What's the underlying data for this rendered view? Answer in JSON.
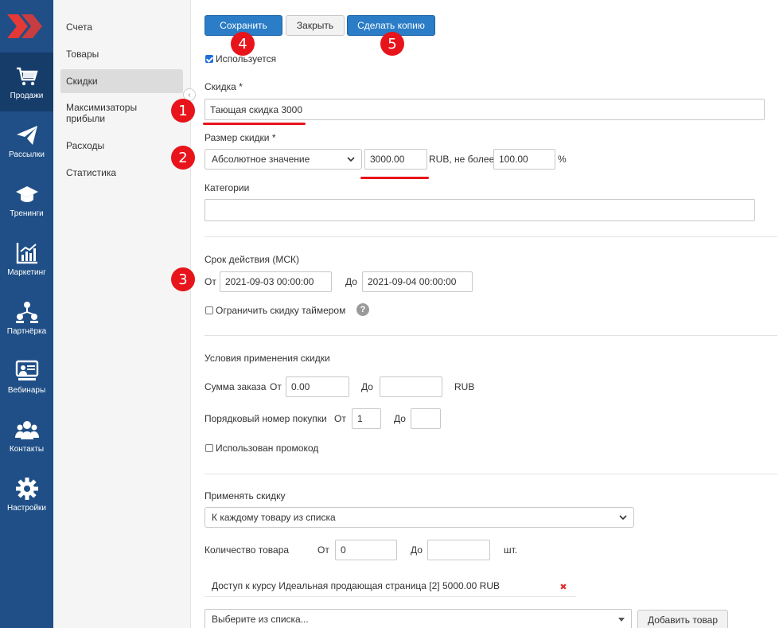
{
  "rail": {
    "items": [
      {
        "label": "Продажи",
        "icon": "cart-icon"
      },
      {
        "label": "Рассылки",
        "icon": "paper-plane-icon"
      },
      {
        "label": "Тренинги",
        "icon": "graduation-cap-icon"
      },
      {
        "label": "Маркетинг",
        "icon": "chart-icon"
      },
      {
        "label": "Партнёрка",
        "icon": "partners-icon"
      },
      {
        "label": "Вебинары",
        "icon": "webinar-icon"
      },
      {
        "label": "Контакты",
        "icon": "contacts-icon"
      },
      {
        "label": "Настройки",
        "icon": "gear-icon"
      }
    ]
  },
  "submenu": {
    "items": [
      {
        "label": "Счета"
      },
      {
        "label": "Товары"
      },
      {
        "label": "Скидки"
      },
      {
        "label": "Максимизаторы прибыли"
      },
      {
        "label": "Расходы"
      },
      {
        "label": "Статистика"
      }
    ]
  },
  "toolbar": {
    "save_label": "Сохранить",
    "close_label": "Закрыть",
    "copy_label": "Сделать копию"
  },
  "form": {
    "active_label": "Используется",
    "discount_label": "Скидка *",
    "discount_value": "Тающая скидка 3000",
    "size_label": "Размер скидки *",
    "size_type": "Абсолютное значение",
    "size_value": "3000.00",
    "size_suffix": "RUB, не более",
    "max_value": "100.00",
    "percent": "%",
    "categories_label": "Категории",
    "categories_value": "",
    "period_label": "Срок действия (МСК)",
    "from_label": "От",
    "from_value": "2021-09-03 00:00:00",
    "to_label": "До",
    "to_value": "2021-09-04 00:00:00",
    "timer_label": "Ограничить скидку таймером",
    "help_glyph": "?",
    "conditions_label": "Условия применения скидки",
    "sum_label": "Сумма заказа",
    "sum_from_label": "От",
    "sum_from_value": "0.00",
    "sum_to_label": "До",
    "sum_to_value": "",
    "sum_currency": "RUB",
    "order_num_label": "Порядковый номер покупки",
    "order_from_label": "От",
    "order_from_value": "1",
    "order_to_label": "До",
    "order_to_value": "",
    "promo_label": "Использован промокод",
    "apply_label": "Применять скидку",
    "apply_value": "К каждому товару из списка",
    "qty_label": "Количество товара",
    "qty_from_label": "От",
    "qty_from_value": "0",
    "qty_to_label": "До",
    "qty_to_value": "",
    "qty_unit": "шт.",
    "product_item": "Доступ к курсу Идеальная продающая страница [2] 5000.00 RUB",
    "product_select_placeholder": "Выберите из списка...",
    "add_product_label": "Добавить товар"
  },
  "annotations": [
    "1",
    "2",
    "3",
    "4",
    "5"
  ],
  "colors": {
    "rail_bg": "#1f4f86",
    "primary_button": "#2a7dc6",
    "annotation_red": "#e8141b"
  }
}
